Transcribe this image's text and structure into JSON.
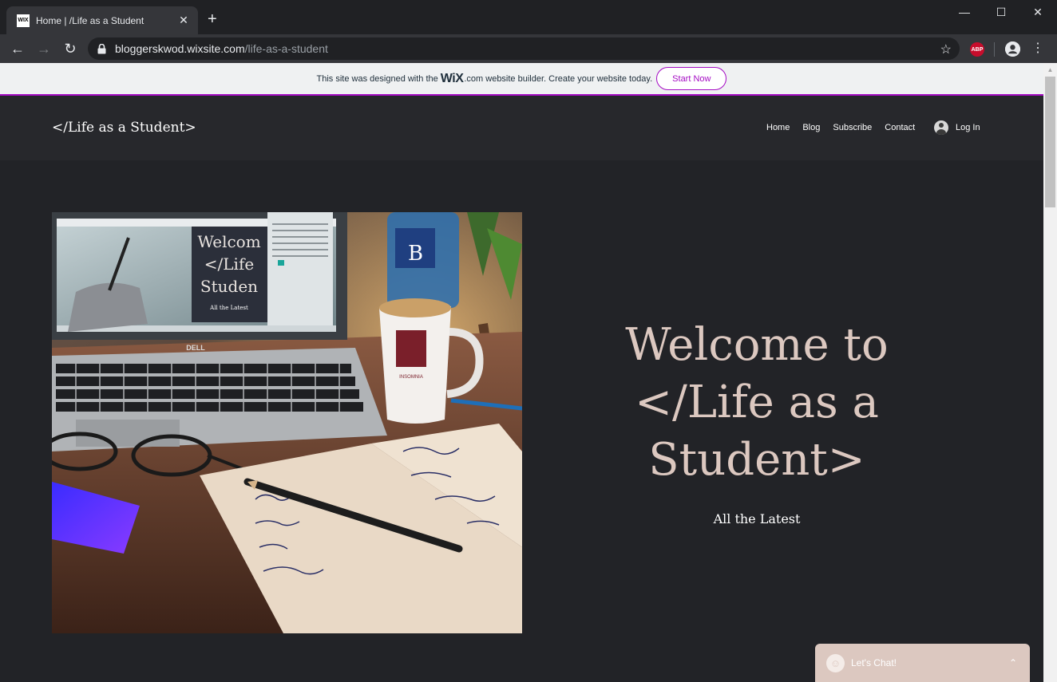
{
  "browser": {
    "tab_title": "Home | /Life as a Student",
    "favicon_text": "WIX",
    "url_host": "bloggerskwod.wixsite.com",
    "url_path": "/life-as-a-student",
    "abp_label": "ABP"
  },
  "wix_banner": {
    "text_before": "This site was designed with the",
    "logo_text": "WiX",
    "text_after": ".com website builder. Create your website today.",
    "cta_label": "Start Now",
    "accent_color": "#a50cc4"
  },
  "site": {
    "title": "</Life as a Student>",
    "nav": [
      "Home",
      "Blog",
      "Subscribe",
      "Contact"
    ],
    "login_label": "Log In"
  },
  "hero": {
    "heading": "Welcome to </Life as a Student>",
    "subheading": "All the Latest",
    "heading_color": "#dcc8c0",
    "photo": {
      "screen_title": "Welcome to </Life as a Student>",
      "screen_subtitle": "All the Latest",
      "laptop_brand": "DELL",
      "mug_brand": "INSOMNIA"
    }
  },
  "chat": {
    "label": "Let's Chat!"
  }
}
